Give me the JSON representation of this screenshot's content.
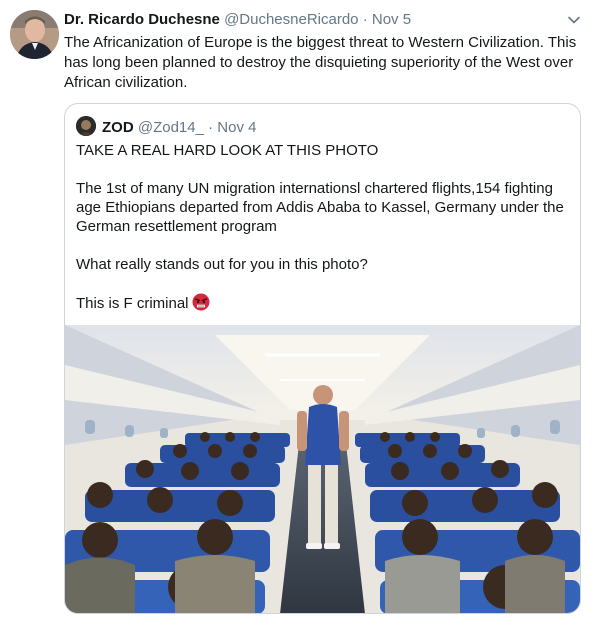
{
  "tweet": {
    "author_name": "Dr. Ricardo Duchesne",
    "handle": "@DuchesneRicardo",
    "separator": "·",
    "date": "Nov 5",
    "text": "The Africanization of Europe is the biggest threat to Western Civilization. This has long been planned to destroy the disquieting superiority of the West over African civilization."
  },
  "quoted": {
    "author_name": "ZOD",
    "handle": "@Zod14_",
    "separator": "·",
    "date": "Nov 4",
    "paragraphs": [
      "TAKE A REAL HARD LOOK AT THIS PHOTO",
      "The 1st of many UN migration internationsl chartered flights,154 fighting age Ethiopians departed from Addis Ababa to Kassel, Germany under the German resettlement program",
      "What really stands out for you in this photo?"
    ],
    "last_line": "This is F criminal",
    "emoji_icon": "angry-face-emoji-icon"
  },
  "icons": {
    "menu": "chevron-down-icon"
  },
  "colors": {
    "text": "#14171a",
    "muted": "#657786",
    "border": "#cdd5dc",
    "cabin_blue": "#2a4f9e"
  }
}
